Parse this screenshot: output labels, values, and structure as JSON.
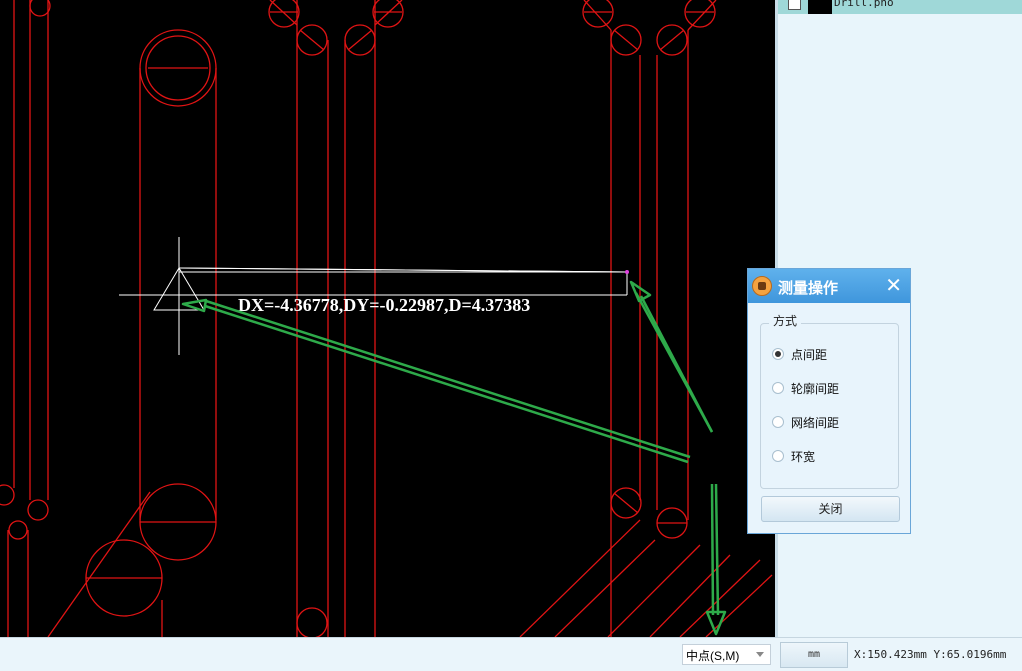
{
  "canvas": {
    "measurement_text": "DX=-4.36778,DY=-0.22987,D=4.37383"
  },
  "layers": {
    "first_name": "Drill.pho"
  },
  "dialog": {
    "title": "测量操作",
    "close_icon": "close-icon",
    "group_label": "方式",
    "options": [
      {
        "label": "点间距",
        "selected": true
      },
      {
        "label": "轮廓间距",
        "selected": false
      },
      {
        "label": "网络间距",
        "selected": false
      },
      {
        "label": "环宽",
        "selected": false
      }
    ],
    "close_button_label": "关闭"
  },
  "status_bar": {
    "snap_mode": "中点(S,M)",
    "unit": "mm",
    "coords": "X:150.423mm Y:65.0196mm"
  },
  "colors": {
    "trace": "#e01414",
    "measure": "#ffffff",
    "annotation_arrow": "#2eaa4a",
    "dialog_title_bg": "#4aa3e6"
  }
}
